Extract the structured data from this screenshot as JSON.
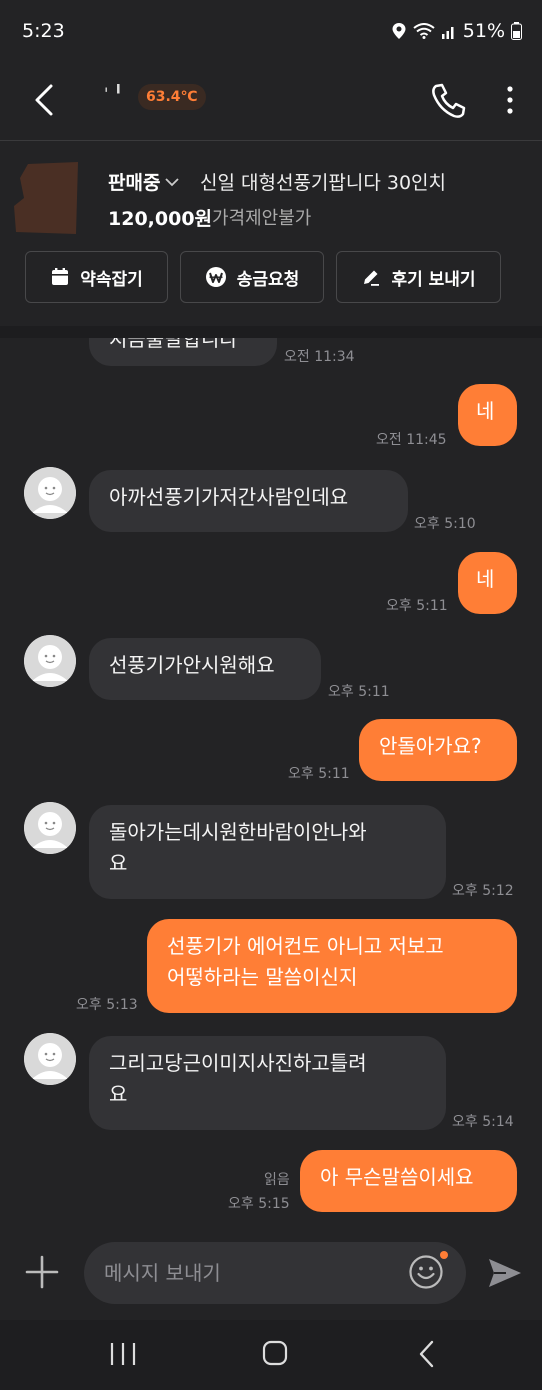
{
  "status_bar": {
    "time": "5:23",
    "battery": "51%"
  },
  "header": {
    "nickname": "' ╹",
    "manner_temp": "63.4℃",
    "icons": [
      "back-arrow-icon",
      "phone-icon",
      "more-vertical-icon"
    ]
  },
  "product": {
    "status": "판매중",
    "title": "신일 대형선풍기팝니다 30인치",
    "price": "120,000원",
    "price_note": "가격제안불가"
  },
  "actions": [
    {
      "label": "약속잡기",
      "icon": "calendar-icon"
    },
    {
      "label": "송금요청",
      "icon": "won-coin-icon"
    },
    {
      "label": "후기 보내기",
      "icon": "pencil-icon"
    }
  ],
  "messages": [
    {
      "from": "other",
      "text": "지금출발합니다",
      "time": "오전 11:34"
    },
    {
      "from": "me",
      "text": "네",
      "time": "오전 11:45"
    },
    {
      "from": "other",
      "text": "아까선풍기가저간사람인데요",
      "time": "오후 5:10"
    },
    {
      "from": "me",
      "text": "네",
      "time": "오후 5:11"
    },
    {
      "from": "other",
      "text": "선풍기가안시원해요",
      "time": "오후 5:11"
    },
    {
      "from": "me",
      "text": "안돌아가요?",
      "time": "오후 5:11"
    },
    {
      "from": "other",
      "lines": [
        "돌아가는데시원한바람이안나와",
        "요"
      ],
      "time": "오후 5:12"
    },
    {
      "from": "me",
      "lines": [
        "선풍기가 에어컨도 아니고 저보고",
        "어떻하라는 말씀이신지"
      ],
      "time": "오후 5:13"
    },
    {
      "from": "other",
      "lines": [
        "그리고당근이미지사진하고틀려",
        "요"
      ],
      "time": "오후 5:14"
    },
    {
      "from": "me",
      "text": "아 무슨말씀이세요",
      "time": "오후 5:15",
      "read_label": "읽음"
    }
  ],
  "input": {
    "placeholder": "메시지 보내기"
  },
  "colors": {
    "accent": "#ff7e36",
    "background": "#232325",
    "bubble_in": "#333336"
  }
}
